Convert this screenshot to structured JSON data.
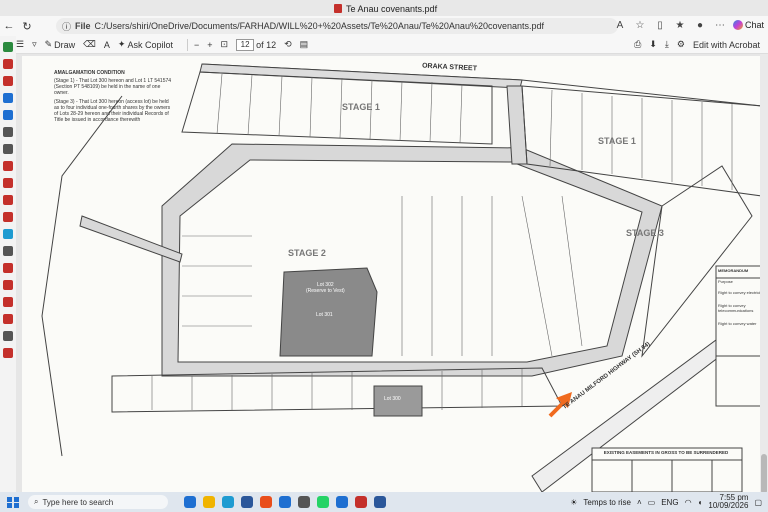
{
  "tab": {
    "title": "Te Anau covenants.pdf"
  },
  "address": {
    "label": "File",
    "url": "C:/Users/shiri/OneDrive/Documents/FARHAD/WILL%20+%20Assets/Te%20Anau/Te%20Anau%20covenants.pdf"
  },
  "browser": {
    "chat_label": "Chat"
  },
  "toolbar": {
    "draw_label": "Draw",
    "copilot_label": "Ask Copilot",
    "page_current": "12",
    "page_total": "of 12",
    "edit_label": "Edit with Acrobat"
  },
  "map": {
    "street_top": "ORAKA STREET",
    "stage1_left": "STAGE 1",
    "stage1_right": "STAGE 1",
    "stage2": "STAGE 2",
    "stage3": "STAGE 3",
    "highway": "TE ANAU MILFORD HIGHWAY (SH 94)",
    "reserve_label": "Lot 302",
    "reserve_sub": "(Reserve to Vest)",
    "reserve2_label": "Lot 301",
    "lot300": "Lot 300",
    "notes_heading": "AMALGAMATION CONDITION",
    "note1": "(Stage 1) - That Lot 300 hereon and Lot 1 LT 541574 (Section PT 548109) be held in the name of one owner.",
    "note2": "(Stage 3) - That Lot 300 hereon (access lot) be held as to four individual one-fourth shares by the owners of Lots 28-29 hereon and their individual Records of Title be issued in accordance therewith",
    "easements_heading": "EXISTING EASEMENTS IN GROSS TO BE SURRENDERED",
    "memo_heading": "MEMORANDUM",
    "purpose": "Purpose",
    "memo_row1": "Right to convey electricity",
    "memo_row2": "Right to convey telecommunications",
    "memo_row3": "Right to convey water"
  },
  "taskbar": {
    "search_placeholder": "Type here to search",
    "weather": "Temps to rise",
    "lang": "ENG",
    "time": "7:55 pm",
    "date": "10/09/2026"
  }
}
